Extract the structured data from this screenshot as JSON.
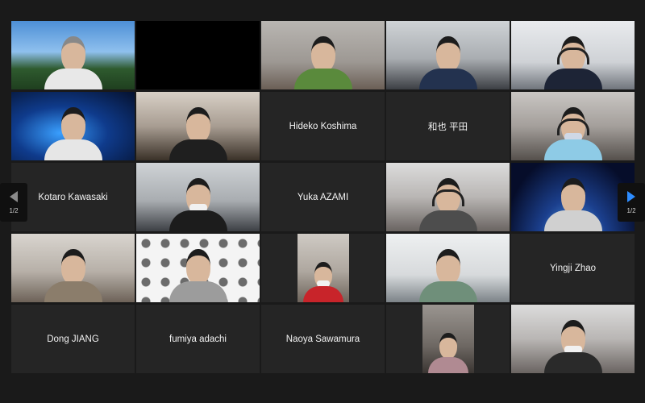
{
  "gallery": {
    "name_labels": {
      "hideko": "Hideko Koshima",
      "kazuya": "和也 平田",
      "kotaro": "Kotaro Kawasaki",
      "yuka": "Yuka AZAMI",
      "yingji": "Yingji Zhao",
      "dong": "Dong JIANG",
      "fumiya": "fumiya adachi",
      "naoya": "Naoya Sawamura"
    }
  },
  "navigation": {
    "prev_page_indicator": "1/2",
    "next_page_indicator": "1/2"
  },
  "colors": {
    "background": "#1a1a1a",
    "tile_background": "#252525",
    "active_accent": "#2d8cff"
  },
  "icons": {
    "prev": "chevron-left-icon",
    "next": "chevron-right-icon"
  }
}
